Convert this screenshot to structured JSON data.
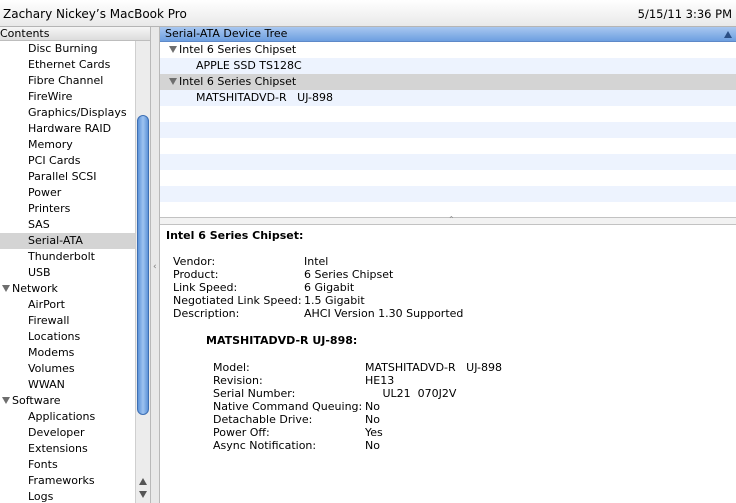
{
  "window": {
    "title": "Zachary Nickey’s MacBook Pro",
    "date": "5/15/11 3:36 PM"
  },
  "sidebar": {
    "header": "Contents",
    "items": [
      {
        "label": "Disc Burning",
        "type": "item"
      },
      {
        "label": "Ethernet Cards",
        "type": "item"
      },
      {
        "label": "Fibre Channel",
        "type": "item"
      },
      {
        "label": "FireWire",
        "type": "item"
      },
      {
        "label": "Graphics/Displays",
        "type": "item"
      },
      {
        "label": "Hardware RAID",
        "type": "item"
      },
      {
        "label": "Memory",
        "type": "item"
      },
      {
        "label": "PCI Cards",
        "type": "item"
      },
      {
        "label": "Parallel SCSI",
        "type": "item"
      },
      {
        "label": "Power",
        "type": "item"
      },
      {
        "label": "Printers",
        "type": "item"
      },
      {
        "label": "SAS",
        "type": "item"
      },
      {
        "label": "Serial-ATA",
        "type": "item",
        "selected": true
      },
      {
        "label": "Thunderbolt",
        "type": "item"
      },
      {
        "label": "USB",
        "type": "item"
      },
      {
        "label": "Network",
        "type": "group"
      },
      {
        "label": "AirPort",
        "type": "item"
      },
      {
        "label": "Firewall",
        "type": "item"
      },
      {
        "label": "Locations",
        "type": "item"
      },
      {
        "label": "Modems",
        "type": "item"
      },
      {
        "label": "Volumes",
        "type": "item"
      },
      {
        "label": "WWAN",
        "type": "item"
      },
      {
        "label": "Software",
        "type": "group"
      },
      {
        "label": "Applications",
        "type": "item"
      },
      {
        "label": "Developer",
        "type": "item"
      },
      {
        "label": "Extensions",
        "type": "item"
      },
      {
        "label": "Fonts",
        "type": "item"
      },
      {
        "label": "Frameworks",
        "type": "item"
      },
      {
        "label": "Logs",
        "type": "item"
      }
    ]
  },
  "tree": {
    "header": "Serial-ATA Device Tree",
    "rows": [
      {
        "label": "Intel 6 Series Chipset",
        "kind": "parent"
      },
      {
        "label": "APPLE SSD TS128C",
        "kind": "child"
      },
      {
        "label": "Intel 6 Series Chipset",
        "kind": "parent",
        "selected": true
      },
      {
        "label": "MATSHITADVD-R   UJ-898",
        "kind": "child"
      }
    ]
  },
  "detail": {
    "title": "Intel 6 Series Chipset:",
    "fields": [
      {
        "key": "Vendor:",
        "value": "Intel"
      },
      {
        "key": "Product:",
        "value": "6 Series Chipset"
      },
      {
        "key": "Link Speed:",
        "value": "6 Gigabit"
      },
      {
        "key": "Negotiated Link Speed:",
        "value": "1.5 Gigabit"
      },
      {
        "key": "Description:",
        "value": "AHCI Version 1.30 Supported"
      }
    ],
    "device": {
      "title": "MATSHITADVD-R   UJ-898:",
      "fields": [
        {
          "key": "Model:",
          "value": "MATSHITADVD-R   UJ-898"
        },
        {
          "key": "Revision:",
          "value": "HE13"
        },
        {
          "key": "Serial Number:",
          "value": "     UL21  070J2V"
        },
        {
          "key": "Native Command Queuing:",
          "value": "No"
        },
        {
          "key": "Detachable Drive:",
          "value": "No"
        },
        {
          "key": "Power Off:",
          "value": "Yes"
        },
        {
          "key": "Async Notification:",
          "value": "No"
        }
      ]
    }
  }
}
